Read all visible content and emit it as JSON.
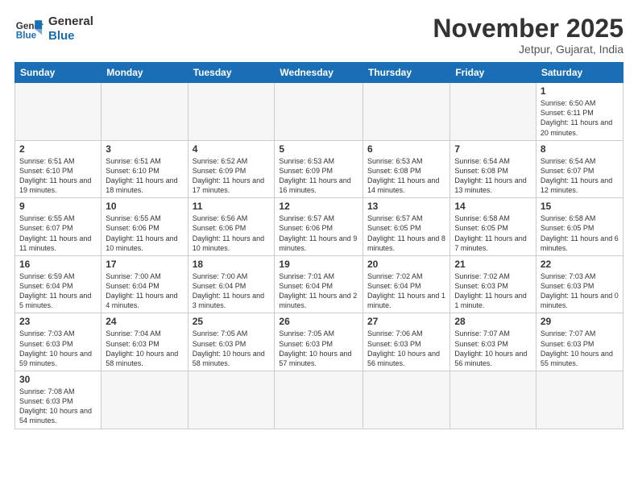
{
  "header": {
    "logo_general": "General",
    "logo_blue": "Blue",
    "title": "November 2025",
    "location": "Jetpur, Gujarat, India"
  },
  "weekdays": [
    "Sunday",
    "Monday",
    "Tuesday",
    "Wednesday",
    "Thursday",
    "Friday",
    "Saturday"
  ],
  "weeks": [
    [
      {
        "day": "",
        "info": ""
      },
      {
        "day": "",
        "info": ""
      },
      {
        "day": "",
        "info": ""
      },
      {
        "day": "",
        "info": ""
      },
      {
        "day": "",
        "info": ""
      },
      {
        "day": "",
        "info": ""
      },
      {
        "day": "1",
        "info": "Sunrise: 6:50 AM\nSunset: 6:11 PM\nDaylight: 11 hours and 20 minutes."
      }
    ],
    [
      {
        "day": "2",
        "info": "Sunrise: 6:51 AM\nSunset: 6:10 PM\nDaylight: 11 hours and 19 minutes."
      },
      {
        "day": "3",
        "info": "Sunrise: 6:51 AM\nSunset: 6:10 PM\nDaylight: 11 hours and 18 minutes."
      },
      {
        "day": "4",
        "info": "Sunrise: 6:52 AM\nSunset: 6:09 PM\nDaylight: 11 hours and 17 minutes."
      },
      {
        "day": "5",
        "info": "Sunrise: 6:53 AM\nSunset: 6:09 PM\nDaylight: 11 hours and 16 minutes."
      },
      {
        "day": "6",
        "info": "Sunrise: 6:53 AM\nSunset: 6:08 PM\nDaylight: 11 hours and 14 minutes."
      },
      {
        "day": "7",
        "info": "Sunrise: 6:54 AM\nSunset: 6:08 PM\nDaylight: 11 hours and 13 minutes."
      },
      {
        "day": "8",
        "info": "Sunrise: 6:54 AM\nSunset: 6:07 PM\nDaylight: 11 hours and 12 minutes."
      }
    ],
    [
      {
        "day": "9",
        "info": "Sunrise: 6:55 AM\nSunset: 6:07 PM\nDaylight: 11 hours and 11 minutes."
      },
      {
        "day": "10",
        "info": "Sunrise: 6:55 AM\nSunset: 6:06 PM\nDaylight: 11 hours and 10 minutes."
      },
      {
        "day": "11",
        "info": "Sunrise: 6:56 AM\nSunset: 6:06 PM\nDaylight: 11 hours and 10 minutes."
      },
      {
        "day": "12",
        "info": "Sunrise: 6:57 AM\nSunset: 6:06 PM\nDaylight: 11 hours and 9 minutes."
      },
      {
        "day": "13",
        "info": "Sunrise: 6:57 AM\nSunset: 6:05 PM\nDaylight: 11 hours and 8 minutes."
      },
      {
        "day": "14",
        "info": "Sunrise: 6:58 AM\nSunset: 6:05 PM\nDaylight: 11 hours and 7 minutes."
      },
      {
        "day": "15",
        "info": "Sunrise: 6:58 AM\nSunset: 6:05 PM\nDaylight: 11 hours and 6 minutes."
      }
    ],
    [
      {
        "day": "16",
        "info": "Sunrise: 6:59 AM\nSunset: 6:04 PM\nDaylight: 11 hours and 5 minutes."
      },
      {
        "day": "17",
        "info": "Sunrise: 7:00 AM\nSunset: 6:04 PM\nDaylight: 11 hours and 4 minutes."
      },
      {
        "day": "18",
        "info": "Sunrise: 7:00 AM\nSunset: 6:04 PM\nDaylight: 11 hours and 3 minutes."
      },
      {
        "day": "19",
        "info": "Sunrise: 7:01 AM\nSunset: 6:04 PM\nDaylight: 11 hours and 2 minutes."
      },
      {
        "day": "20",
        "info": "Sunrise: 7:02 AM\nSunset: 6:04 PM\nDaylight: 11 hours and 1 minute."
      },
      {
        "day": "21",
        "info": "Sunrise: 7:02 AM\nSunset: 6:03 PM\nDaylight: 11 hours and 1 minute."
      },
      {
        "day": "22",
        "info": "Sunrise: 7:03 AM\nSunset: 6:03 PM\nDaylight: 11 hours and 0 minutes."
      }
    ],
    [
      {
        "day": "23",
        "info": "Sunrise: 7:03 AM\nSunset: 6:03 PM\nDaylight: 10 hours and 59 minutes."
      },
      {
        "day": "24",
        "info": "Sunrise: 7:04 AM\nSunset: 6:03 PM\nDaylight: 10 hours and 58 minutes."
      },
      {
        "day": "25",
        "info": "Sunrise: 7:05 AM\nSunset: 6:03 PM\nDaylight: 10 hours and 58 minutes."
      },
      {
        "day": "26",
        "info": "Sunrise: 7:05 AM\nSunset: 6:03 PM\nDaylight: 10 hours and 57 minutes."
      },
      {
        "day": "27",
        "info": "Sunrise: 7:06 AM\nSunset: 6:03 PM\nDaylight: 10 hours and 56 minutes."
      },
      {
        "day": "28",
        "info": "Sunrise: 7:07 AM\nSunset: 6:03 PM\nDaylight: 10 hours and 56 minutes."
      },
      {
        "day": "29",
        "info": "Sunrise: 7:07 AM\nSunset: 6:03 PM\nDaylight: 10 hours and 55 minutes."
      }
    ],
    [
      {
        "day": "30",
        "info": "Sunrise: 7:08 AM\nSunset: 6:03 PM\nDaylight: 10 hours and 54 minutes."
      },
      {
        "day": "",
        "info": ""
      },
      {
        "day": "",
        "info": ""
      },
      {
        "day": "",
        "info": ""
      },
      {
        "day": "",
        "info": ""
      },
      {
        "day": "",
        "info": ""
      },
      {
        "day": "",
        "info": ""
      }
    ]
  ]
}
